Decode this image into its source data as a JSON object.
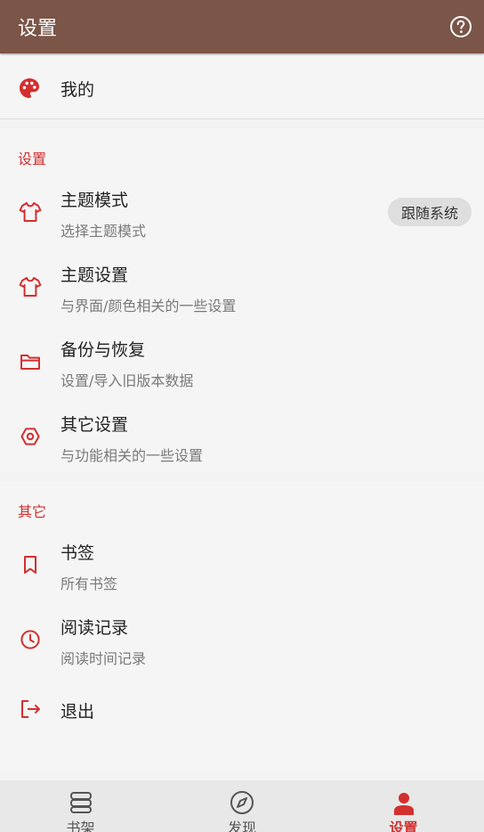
{
  "colors": {
    "appbar": "#7a5548",
    "accent": "#d32f2f"
  },
  "appbar": {
    "title": "设置",
    "help_icon": "question-circle-icon"
  },
  "mine": {
    "label": "我的",
    "icon": "palette-icon"
  },
  "settings_section": {
    "title": "设置",
    "items": [
      {
        "title": "主题模式",
        "subtitle": "选择主题模式",
        "icon": "shirt-icon",
        "value": "跟随系统"
      },
      {
        "title": "主题设置",
        "subtitle": "与界面/颜色相关的一些设置",
        "icon": "shirt-icon"
      },
      {
        "title": "备份与恢复",
        "subtitle": "设置/导入旧版本数据",
        "icon": "folder-icon"
      },
      {
        "title": "其它设置",
        "subtitle": "与功能相关的一些设置",
        "icon": "hexagon-settings-icon"
      }
    ]
  },
  "other_section": {
    "title": "其它",
    "items": [
      {
        "title": "书签",
        "subtitle": "所有书签",
        "icon": "bookmark-icon"
      },
      {
        "title": "阅读记录",
        "subtitle": "阅读时间记录",
        "icon": "clock-icon"
      },
      {
        "title": "退出",
        "icon": "logout-icon"
      }
    ]
  },
  "bottom_nav": [
    {
      "label": "书架",
      "icon": "bookshelf-icon",
      "active": false
    },
    {
      "label": "发现",
      "icon": "compass-icon",
      "active": false
    },
    {
      "label": "设置",
      "icon": "person-icon",
      "active": true
    }
  ]
}
